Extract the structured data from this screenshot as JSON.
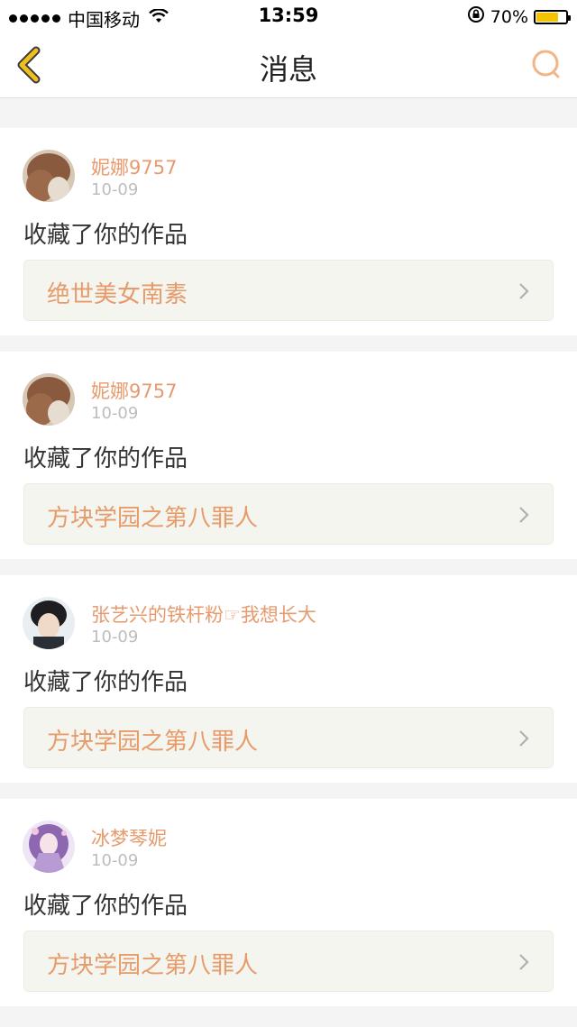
{
  "status_bar": {
    "carrier": "中国移动",
    "time": "13:59",
    "battery_percent": "70%",
    "battery_level": 0.7
  },
  "nav": {
    "title": "消息"
  },
  "colors": {
    "accent": "#e69b6b",
    "back_icon": "#f0c020",
    "search_icon": "#f2b585"
  },
  "messages": [
    {
      "username": "妮娜9757",
      "date": "10-09",
      "action": "收藏了你的作品",
      "work_title": "绝世美女南素",
      "avatar_icon": "avatar-brown-hair"
    },
    {
      "username": "妮娜9757",
      "date": "10-09",
      "action": "收藏了你的作品",
      "work_title": "方块学园之第八罪人",
      "avatar_icon": "avatar-brown-hair"
    },
    {
      "username": "张艺兴的铁杆粉☞我想长大",
      "date": "10-09",
      "action": "收藏了你的作品",
      "work_title": "方块学园之第八罪人",
      "avatar_icon": "avatar-dark-hair"
    },
    {
      "username": "冰梦琴妮",
      "date": "10-09",
      "action": "收藏了你的作品",
      "work_title": "方块学园之第八罪人",
      "avatar_icon": "avatar-anime-purple"
    }
  ]
}
